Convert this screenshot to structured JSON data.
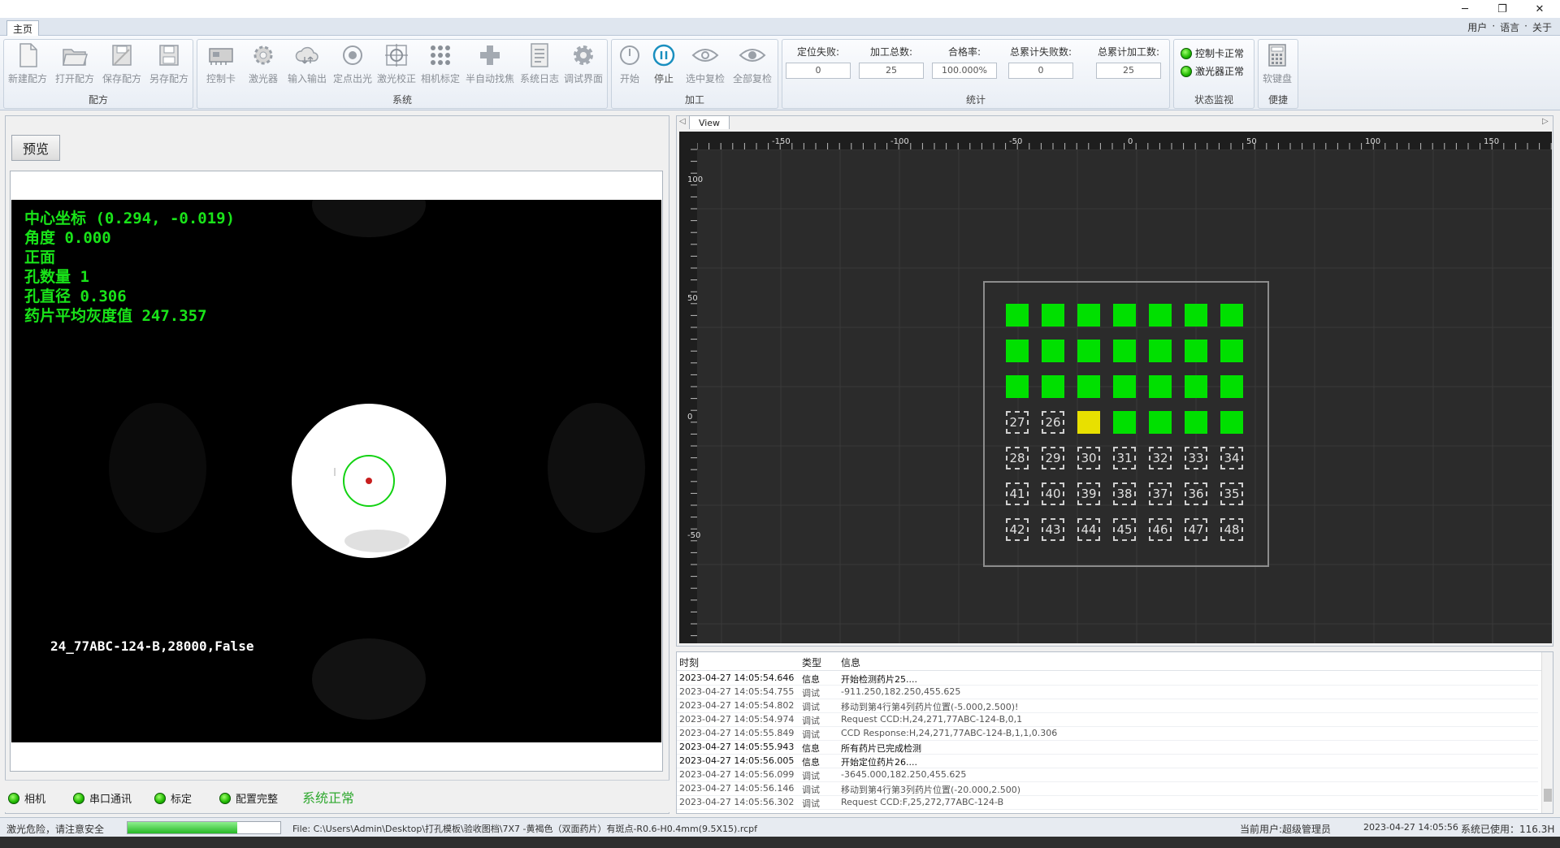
{
  "window": {
    "controls": [
      "─",
      "❐",
      "✕"
    ]
  },
  "top_tab": "主页",
  "top_menu": [
    "用户",
    "·",
    "语言",
    "·",
    "关于"
  ],
  "ribbon": {
    "groups": {
      "recipe": "配方",
      "system": "系统",
      "process": "加工",
      "stats": "统计",
      "monitor": "状态监视",
      "convenient": "便捷"
    },
    "recipe_buttons": [
      "新建配方",
      "打开配方",
      "保存配方",
      "另存配方"
    ],
    "system_buttons": [
      "控制卡",
      "激光器",
      "输入输出",
      "定点出光",
      "激光校正",
      "相机标定",
      "半自动找焦",
      "系统日志",
      "调试界面"
    ],
    "process_buttons": [
      "开始",
      "停止",
      "选中复检",
      "全部复检"
    ],
    "stats": [
      {
        "label": "定位失败:",
        "value": "0"
      },
      {
        "label": "加工总数:",
        "value": "25"
      },
      {
        "label": "合格率:",
        "value": "100.000%"
      },
      {
        "label": "总累计失败数:",
        "value": "0"
      },
      {
        "label": "总累计加工数:",
        "value": "25"
      }
    ],
    "monitor": [
      "控制卡正常",
      "激光器正常"
    ],
    "keyboard": "软键盘"
  },
  "preview": {
    "button": "预览",
    "overlay": [
      "中心坐标 (0.294, -0.019)",
      "角度 0.000",
      "正面",
      "孔数量 1",
      "孔直径 0.306",
      "药片平均灰度值 247.357"
    ],
    "footer": "24_77ABC-124-B,28000,False"
  },
  "status_items": [
    "相机",
    "串口通讯",
    "标定",
    "配置完整"
  ],
  "system_status": "系统正常",
  "view": {
    "tab": "View",
    "x_ticks": [
      "-150",
      "-100",
      "-50",
      "0",
      "50",
      "100",
      "150"
    ],
    "y_ticks": [
      "100",
      "50",
      "0",
      "-50"
    ],
    "grid_rows": [
      [
        "g",
        "g",
        "g",
        "g",
        "g",
        "g",
        "g"
      ],
      [
        "g",
        "g",
        "g",
        "g",
        "g",
        "g",
        "g"
      ],
      [
        "g",
        "g",
        "g",
        "g",
        "g",
        "g",
        "g"
      ],
      [
        "e",
        "e",
        "y",
        "g",
        "g",
        "g",
        "g"
      ],
      [
        "e",
        "e",
        "e",
        "e",
        "e",
        "e",
        "e"
      ],
      [
        "e",
        "e",
        "e",
        "e",
        "e",
        "e",
        "e"
      ],
      [
        "e",
        "e",
        "e",
        "e",
        "e",
        "e",
        "e"
      ]
    ],
    "grid_labels": [
      [
        "",
        "",
        "",
        "",
        "",
        "",
        ""
      ],
      [
        "",
        "",
        "",
        "",
        "",
        "",
        ""
      ],
      [
        "",
        "",
        "",
        "",
        "",
        "",
        ""
      ],
      [
        "27",
        "26",
        "",
        "",
        "",
        "",
        ""
      ],
      [
        "28",
        "29",
        "30",
        "31",
        "32",
        "33",
        "34"
      ],
      [
        "41",
        "40",
        "39",
        "38",
        "37",
        "36",
        "35"
      ],
      [
        "42",
        "43",
        "44",
        "45",
        "46",
        "47",
        "48"
      ]
    ]
  },
  "log": {
    "headers": [
      "时刻",
      "类型",
      "信息"
    ],
    "rows": [
      {
        "time": "2023-04-27 14:05:54.646",
        "type": "信息",
        "msg": "开始检测药片25...."
      },
      {
        "time": "2023-04-27 14:05:54.755",
        "type": "调试",
        "msg": "-911.250,182.250,455.625"
      },
      {
        "time": "2023-04-27 14:05:54.802",
        "type": "调试",
        "msg": "移动到第4行第4列药片位置(-5.000,2.500)!"
      },
      {
        "time": "2023-04-27 14:05:54.974",
        "type": "调试",
        "msg": "Request CCD:H,24,271,77ABC-124-B,0,1"
      },
      {
        "time": "2023-04-27 14:05:55.849",
        "type": "调试",
        "msg": "CCD Response:H,24,271,77ABC-124-B,1,1,0.306"
      },
      {
        "time": "2023-04-27 14:05:55.943",
        "type": "信息",
        "msg": "所有药片已完成检测"
      },
      {
        "time": "2023-04-27 14:05:56.005",
        "type": "信息",
        "msg": "开始定位药片26...."
      },
      {
        "time": "2023-04-27 14:05:56.099",
        "type": "调试",
        "msg": "-3645.000,182.250,455.625"
      },
      {
        "time": "2023-04-27 14:05:56.146",
        "type": "调试",
        "msg": "移动到第4行第3列药片位置(-20.000,2.500)"
      },
      {
        "time": "2023-04-27 14:05:56.302",
        "type": "调试",
        "msg": "Request CCD:F,25,272,77ABC-124-B"
      }
    ]
  },
  "statusbar": {
    "warning": "激光危险，请注意安全",
    "progress": 0.72,
    "file": "File: C:\\Users\\Admin\\Desktop\\打孔模板\\验收图档\\7X7 -黄褐色（双面药片）有斑点-R0.6-H0.4mm(9.5X15).rcpf",
    "user": "当前用户:超级管理员",
    "time": "2023-04-27 14:05:56",
    "uptime": "系统已使用：116.3H"
  }
}
